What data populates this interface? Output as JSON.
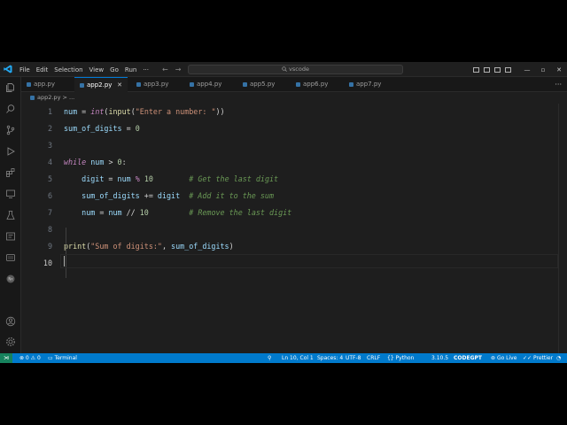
{
  "menu": [
    "File",
    "Edit",
    "Selection",
    "View",
    "Go",
    "Run",
    "···"
  ],
  "nav": {
    "back": "←",
    "forward": "→"
  },
  "search": {
    "text": "vscode"
  },
  "window_controls": {
    "minimize": "—",
    "maximize": "▫",
    "close": "✕"
  },
  "tabs": [
    {
      "label": "app.py",
      "active": false
    },
    {
      "label": "app2.py",
      "active": true
    },
    {
      "label": "app3.py",
      "active": false
    },
    {
      "label": "app4.py",
      "active": false
    },
    {
      "label": "app5.py",
      "active": false
    },
    {
      "label": "app6.py",
      "active": false
    },
    {
      "label": "app7.py",
      "active": false
    }
  ],
  "tab_close": "✕",
  "tab_more": "···",
  "breadcrumb": {
    "file": "app2.py",
    "more": "> ..."
  },
  "editor": {
    "line_numbers": [
      "1",
      "2",
      "3",
      "4",
      "5",
      "6",
      "7",
      "8",
      "9",
      "10"
    ],
    "current_line": 10,
    "lines": [
      [
        {
          "t": "var",
          "s": "num"
        },
        {
          "t": "op",
          "s": " = "
        },
        {
          "t": "kw",
          "s": "int"
        },
        {
          "t": "op",
          "s": "("
        },
        {
          "t": "fn",
          "s": "input"
        },
        {
          "t": "op",
          "s": "("
        },
        {
          "t": "str",
          "s": "\"Enter a number: \""
        },
        {
          "t": "op",
          "s": "))"
        }
      ],
      [
        {
          "t": "var",
          "s": "sum_of_digits"
        },
        {
          "t": "op",
          "s": " = "
        },
        {
          "t": "num",
          "s": "0"
        }
      ],
      [],
      [
        {
          "t": "kw",
          "s": "while"
        },
        {
          "t": "op",
          "s": " "
        },
        {
          "t": "var",
          "s": "num"
        },
        {
          "t": "op",
          "s": " > "
        },
        {
          "t": "num",
          "s": "0"
        },
        {
          "t": "op",
          "s": ":"
        }
      ],
      [
        {
          "t": "op",
          "s": "    "
        },
        {
          "t": "var",
          "s": "digit"
        },
        {
          "t": "op",
          "s": " = "
        },
        {
          "t": "var",
          "s": "num"
        },
        {
          "t": "op",
          "s": " "
        },
        {
          "t": "kw",
          "s": "%"
        },
        {
          "t": "op",
          "s": " "
        },
        {
          "t": "num",
          "s": "10"
        },
        {
          "t": "op",
          "s": "        "
        },
        {
          "t": "cmt",
          "s": "# Get the last digit"
        }
      ],
      [
        {
          "t": "op",
          "s": "    "
        },
        {
          "t": "var",
          "s": "sum_of_digits"
        },
        {
          "t": "op",
          "s": " += "
        },
        {
          "t": "var",
          "s": "digit"
        },
        {
          "t": "op",
          "s": "  "
        },
        {
          "t": "cmt",
          "s": "# Add it to the sum"
        }
      ],
      [
        {
          "t": "op",
          "s": "    "
        },
        {
          "t": "var",
          "s": "num"
        },
        {
          "t": "op",
          "s": " = "
        },
        {
          "t": "var",
          "s": "num"
        },
        {
          "t": "op",
          "s": " // "
        },
        {
          "t": "num",
          "s": "10"
        },
        {
          "t": "op",
          "s": "         "
        },
        {
          "t": "cmt",
          "s": "# Remove the last digit"
        }
      ],
      [],
      [
        {
          "t": "fn",
          "s": "print"
        },
        {
          "t": "op",
          "s": "("
        },
        {
          "t": "str",
          "s": "\"Sum of digits:\""
        },
        {
          "t": "op",
          "s": ", "
        },
        {
          "t": "var",
          "s": "sum_of_digits"
        },
        {
          "t": "op",
          "s": ")"
        }
      ],
      []
    ]
  },
  "status": {
    "remote": "⋊",
    "problems": "⊗ 0 ⚠ 0",
    "terminal": "Terminal",
    "position": "Ln 10, Col 1",
    "spaces": "Spaces: 4",
    "encoding": "UTF-8",
    "eol": "CRLF",
    "language": "Python",
    "version": "3.10.5",
    "codegpt": "CODEGPT",
    "golive": "Go Live",
    "prettier": "Prettier",
    "bell": "🔔"
  },
  "colors": {
    "accent": "#007acc",
    "editor_bg": "#1e1e1e",
    "remote": "#16825d"
  }
}
